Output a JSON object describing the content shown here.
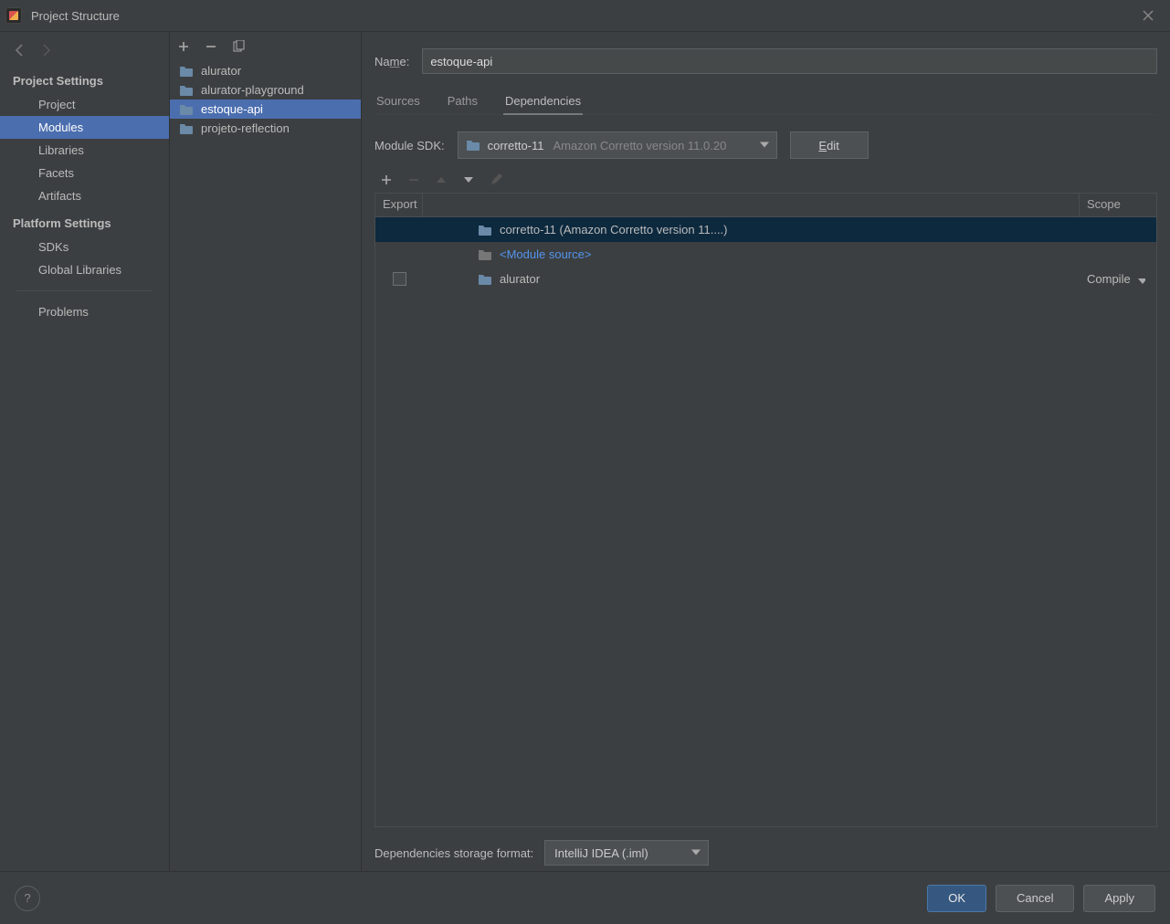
{
  "window": {
    "title": "Project Structure"
  },
  "nav": {
    "section1": "Project Settings",
    "items1": [
      "Project",
      "Modules",
      "Libraries",
      "Facets",
      "Artifacts"
    ],
    "selected1": 1,
    "section2": "Platform Settings",
    "items2": [
      "SDKs",
      "Global Libraries"
    ],
    "problems": "Problems"
  },
  "modules": {
    "list": [
      "alurator",
      "alurator-playground",
      "estoque-api",
      "projeto-reflection"
    ],
    "selected": 2
  },
  "main": {
    "name_label": "Name:",
    "name_value": "estoque-api",
    "tabs": [
      "Sources",
      "Paths",
      "Dependencies"
    ],
    "active_tab": 2,
    "sdk_label": "Module SDK:",
    "sdk_name": "corretto-11",
    "sdk_detail": "Amazon Corretto version 11.0.20",
    "edit": "Edit",
    "dep_head_export": "Export",
    "dep_head_scope": "Scope",
    "deps": [
      {
        "label": "corretto-11 (Amazon Corretto version 11....)",
        "kind": "sdk",
        "selected": true
      },
      {
        "label": "<Module source>",
        "kind": "source"
      },
      {
        "label": "alurator",
        "kind": "module",
        "has_export": true,
        "scope": "Compile"
      }
    ],
    "storage_label": "Dependencies storage format:",
    "storage_value": "IntelliJ IDEA (.iml)"
  },
  "footer": {
    "ok": "OK",
    "cancel": "Cancel",
    "apply": "Apply"
  }
}
